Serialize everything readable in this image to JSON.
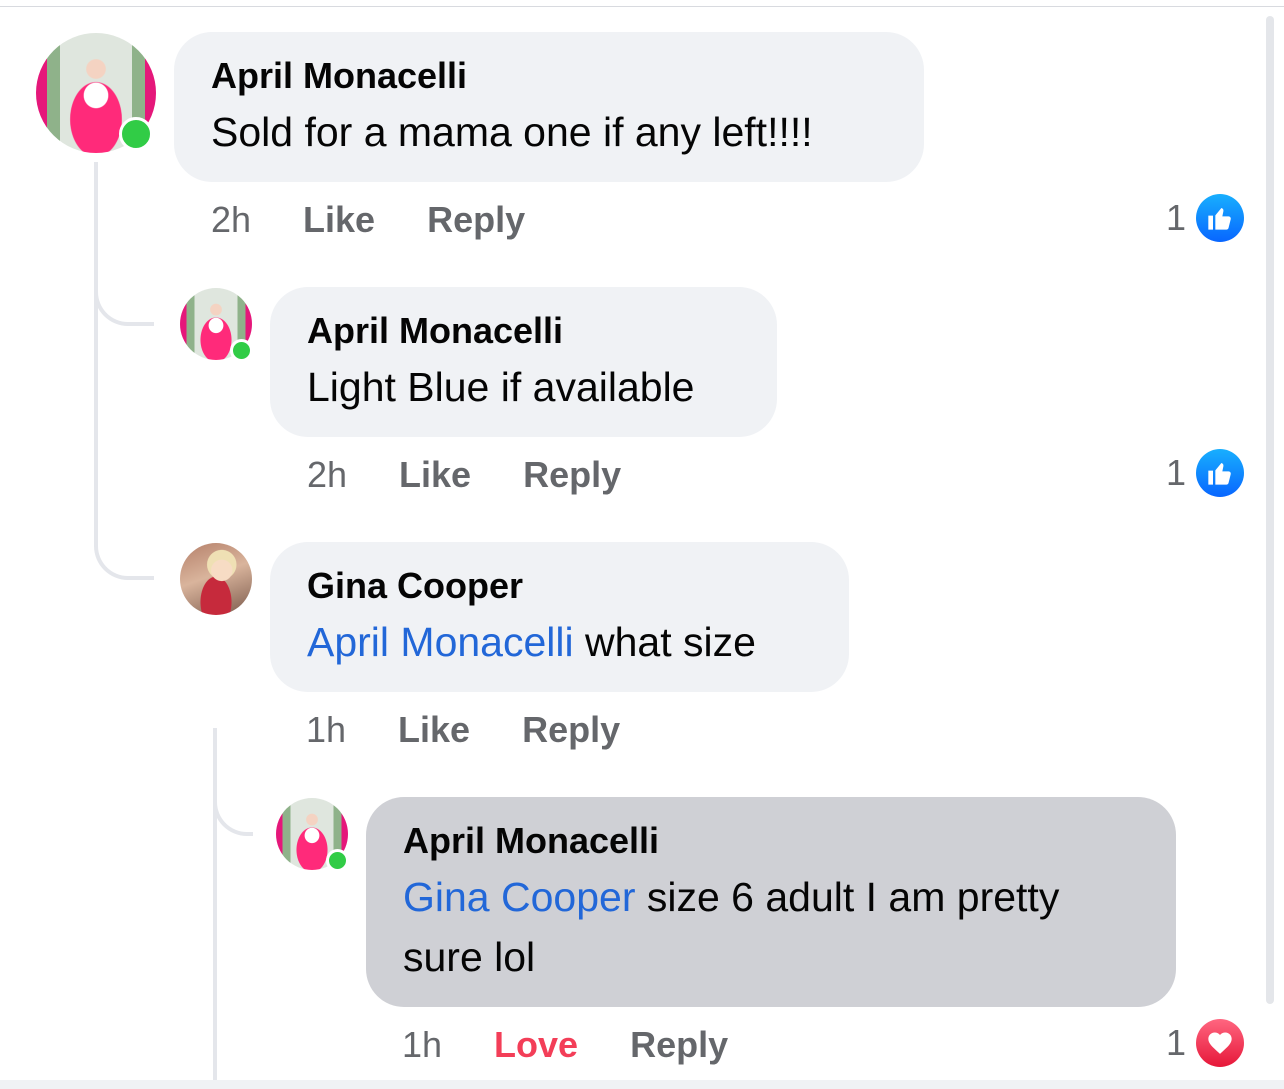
{
  "comments": [
    {
      "author": "April Monacelli",
      "text": "Sold for a mama one if any left!!!!",
      "time": "2h",
      "action": "Like",
      "reply_label": "Reply",
      "reaction_count": "1",
      "reaction_type": "like-icon"
    },
    {
      "author": "April Monacelli",
      "text": "Light Blue if available",
      "time": "2h",
      "action": "Like",
      "reply_label": "Reply",
      "reaction_count": "1",
      "reaction_type": "like-icon"
    },
    {
      "author": "Gina Cooper",
      "mention": "April Monacelli",
      "text": " what size",
      "time": "1h",
      "action": "Like",
      "reply_label": "Reply"
    },
    {
      "author": "April Monacelli",
      "mention": "Gina Cooper",
      "text": " size 6 adult I am pretty sure lol",
      "time": "1h",
      "action": "Love",
      "reply_label": "Reply",
      "reaction_count": "1",
      "reaction_type": "love-icon"
    }
  ],
  "colors": {
    "mention": "#2267d8",
    "love": "#f33e58",
    "like": "#0866ff",
    "online": "#31cc46",
    "bubble": "#f0f2f5",
    "bubble_highlight": "#cfd0d5"
  }
}
